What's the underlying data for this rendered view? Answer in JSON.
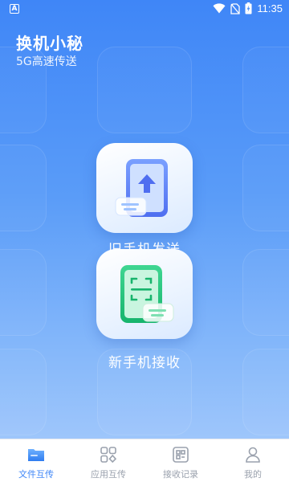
{
  "status_bar": {
    "app_indicator": "A",
    "time": "11:35",
    "icons": [
      "wifi-icon",
      "no-sim-icon",
      "battery-charging-icon"
    ]
  },
  "header": {
    "title": "换机小秘",
    "subtitle": "5G高速传送"
  },
  "actions": {
    "send": {
      "label": "旧手机发送",
      "icon": "phone-upload-icon"
    },
    "receive": {
      "label": "新手机接收",
      "icon": "phone-scan-icon"
    }
  },
  "tabbar": {
    "items": [
      {
        "label": "文件互传",
        "icon": "folder-icon",
        "active": true
      },
      {
        "label": "应用互传",
        "icon": "apps-icon",
        "active": false
      },
      {
        "label": "接收记录",
        "icon": "record-icon",
        "active": false
      },
      {
        "label": "我的",
        "icon": "user-icon",
        "active": false
      }
    ]
  },
  "colors": {
    "brand": "#3f86f7",
    "tab_inactive": "#9aa1ad",
    "send_icon": "#5b7cf6",
    "receive_icon": "#22c17a"
  }
}
